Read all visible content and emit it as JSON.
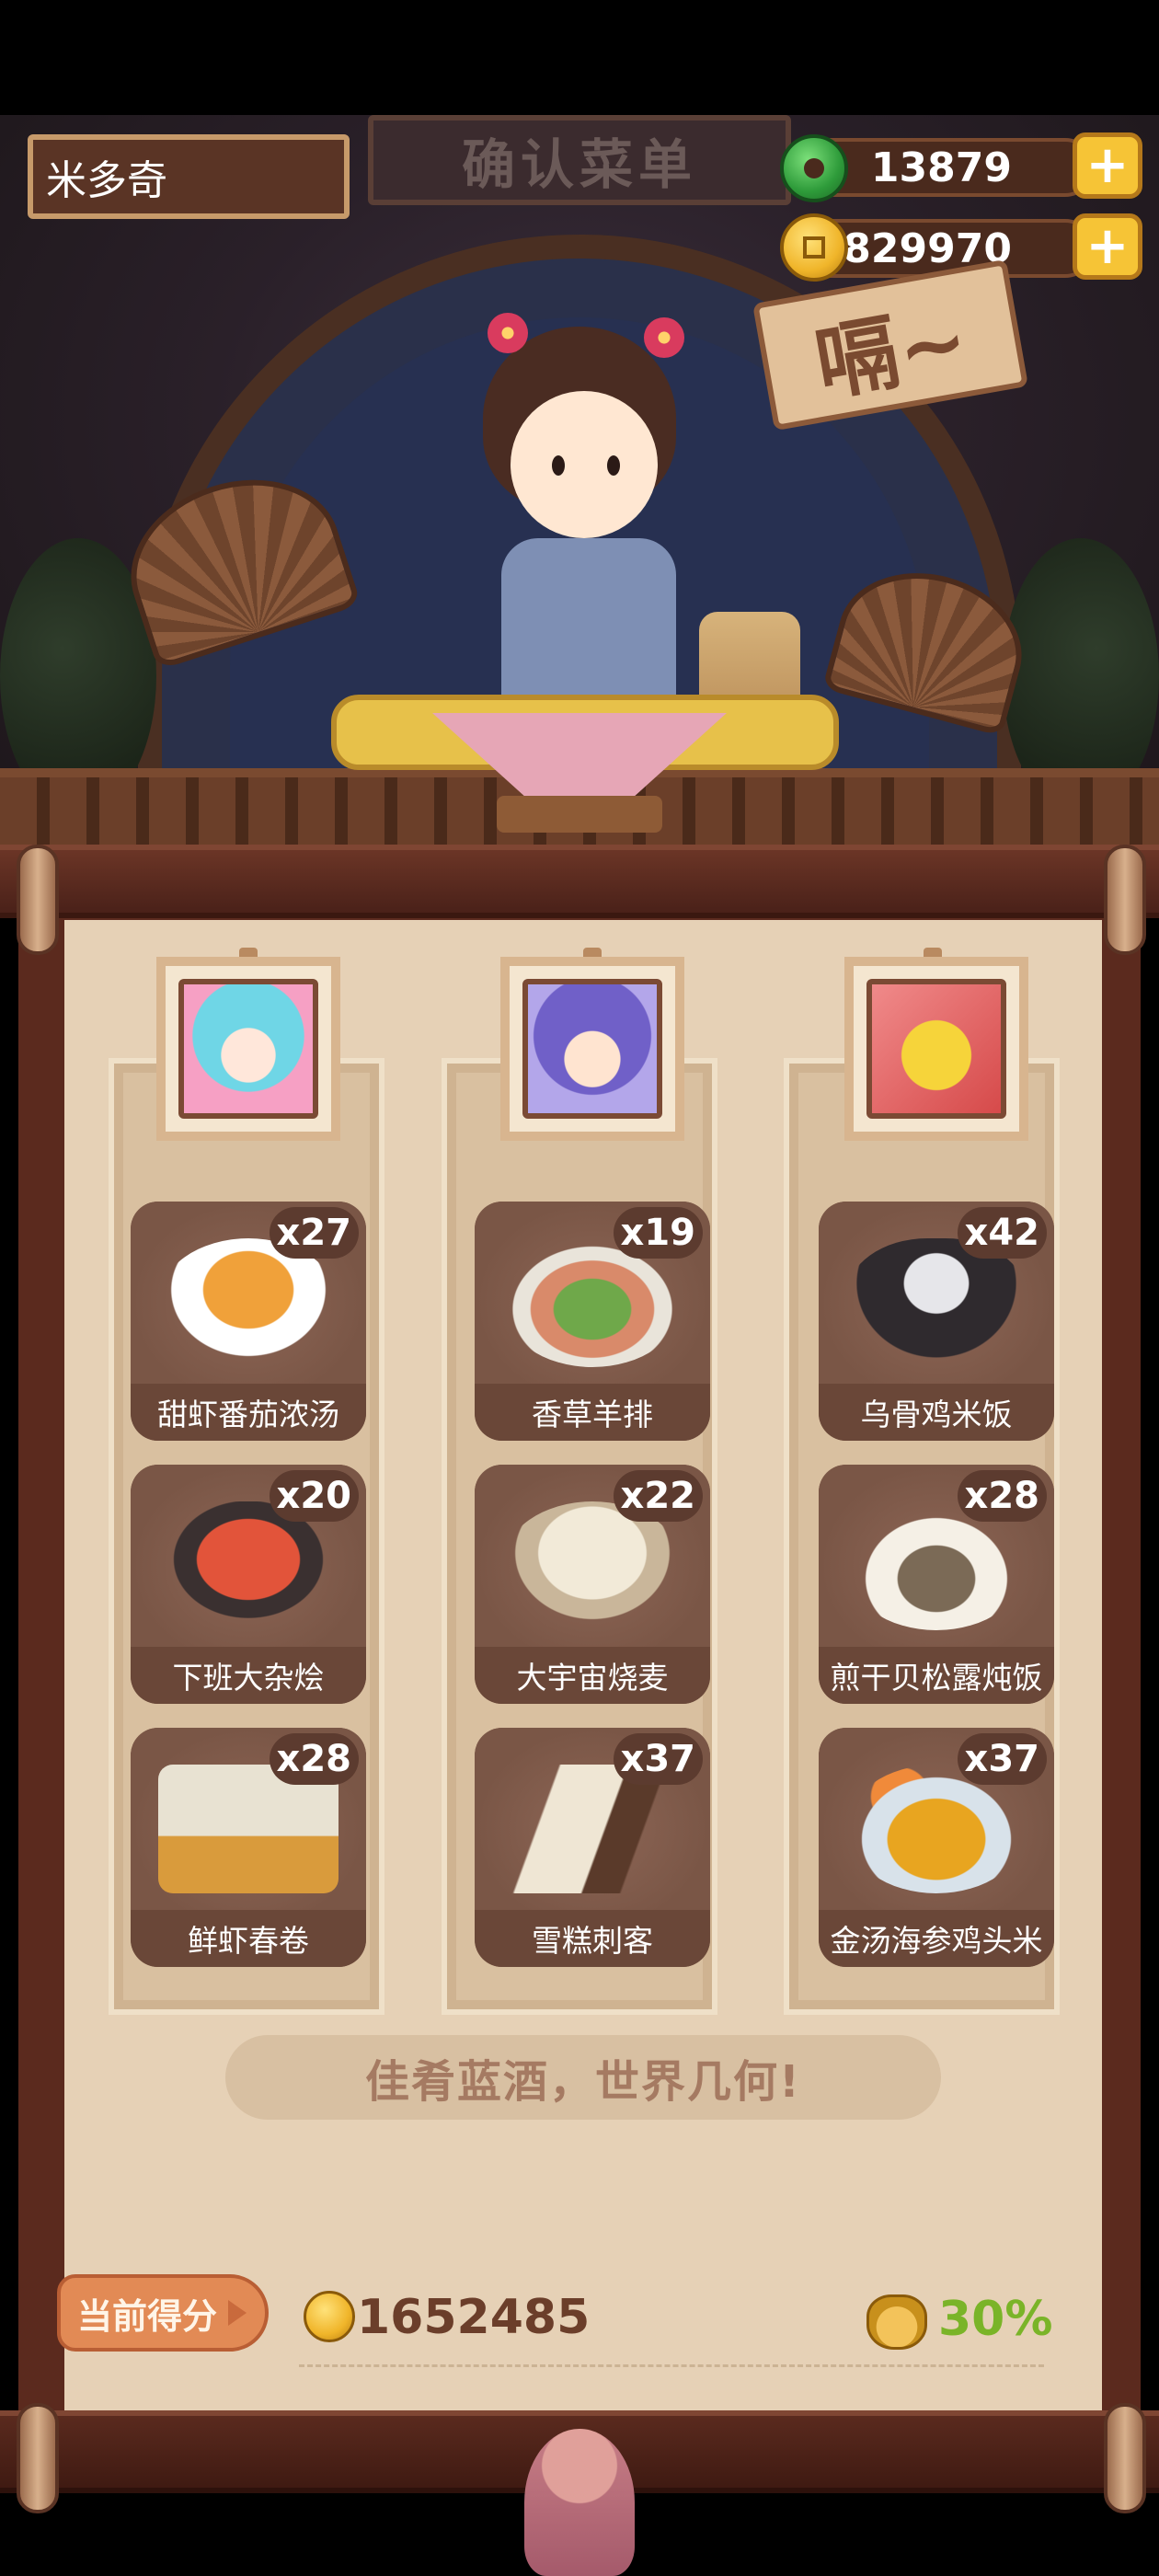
{
  "header": {
    "player_name": "米多奇",
    "sign_title": "确认菜单",
    "jade_amount": "13879",
    "coin_amount": "12829970",
    "bubble_text": "嗝~",
    "plus_label": "+"
  },
  "columns": [
    {
      "guest_name": "guest-1",
      "dishes": [
        {
          "name": "甜虾番茄浓汤",
          "count": "x27"
        },
        {
          "name": "下班大杂烩",
          "count": "x20"
        },
        {
          "name": "鲜虾春卷",
          "count": "x28"
        }
      ]
    },
    {
      "guest_name": "guest-2",
      "dishes": [
        {
          "name": "香草羊排",
          "count": "x19"
        },
        {
          "name": "大宇宙烧麦",
          "count": "x22"
        },
        {
          "name": "雪糕刺客",
          "count": "x37"
        }
      ]
    },
    {
      "guest_name": "guest-3",
      "dishes": [
        {
          "name": "乌骨鸡米饭",
          "count": "x42"
        },
        {
          "name": "煎干贝松露炖饭",
          "count": "x28"
        },
        {
          "name": "金汤海参鸡头米",
          "count": "x37"
        }
      ]
    }
  ],
  "slogan": "佳肴蓝酒，世界几何!",
  "score": {
    "label": "当前得分",
    "value": "1652485",
    "bonus": "30%"
  },
  "colors": {
    "paper": "#e6d1b6",
    "frame": "#5b2a1e",
    "dish_card": "#7a5646",
    "score_button": "#e28a55",
    "bonus_green": "#7ab428"
  },
  "icons": [
    "jade-icon",
    "coin-icon",
    "plus-icon",
    "bonus-pot-icon",
    "score-coin-icon"
  ]
}
